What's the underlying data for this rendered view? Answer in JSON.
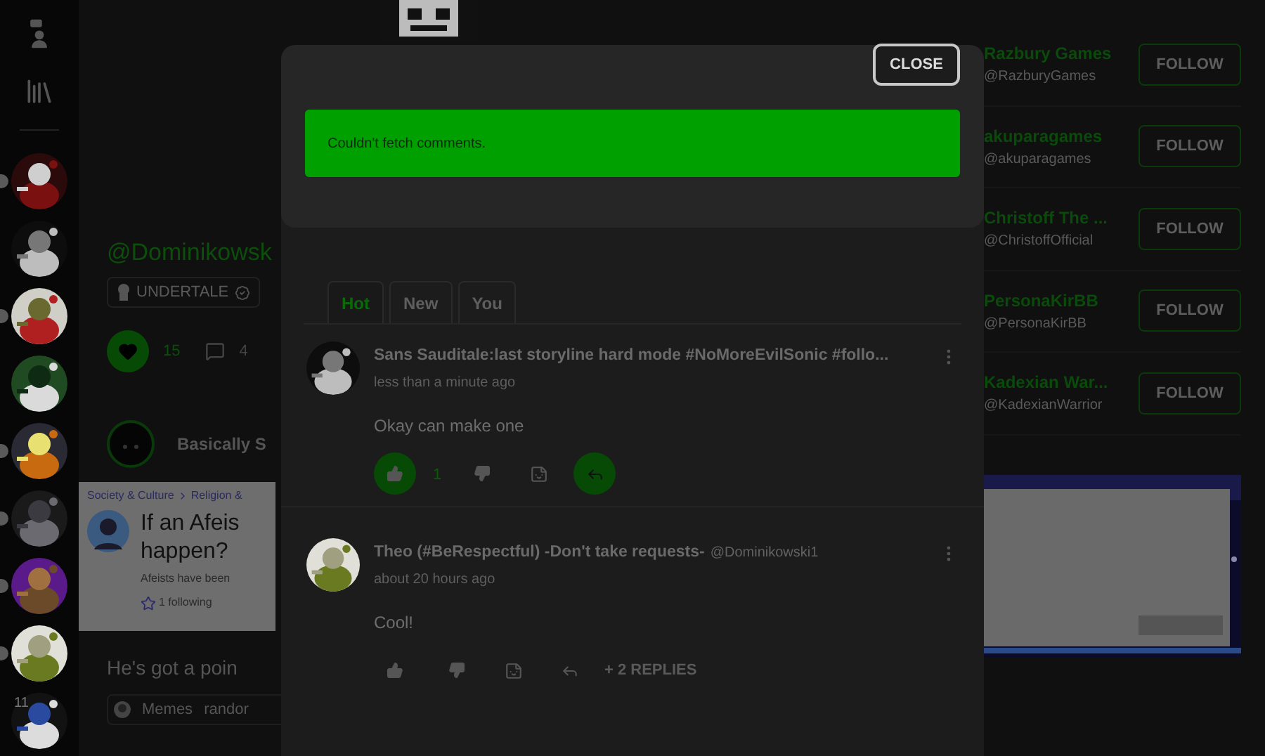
{
  "sidebar": {
    "avatars": [
      {
        "unread": true
      },
      {
        "unread": false
      },
      {
        "unread": true
      },
      {
        "unread": false
      },
      {
        "unread": true
      },
      {
        "unread": true
      },
      {
        "unread": true
      },
      {
        "unread": true
      },
      {
        "unread": false,
        "badge": "11"
      }
    ]
  },
  "feed": {
    "post": {
      "handle": "@Dominikowsk",
      "tag": "UNDERTALE",
      "liked": true,
      "likes": "15",
      "comments": "4"
    },
    "post_2": {
      "author": "Basically S",
      "embed": {
        "breadcrumb": [
          "Society & Culture",
          "Religion &"
        ],
        "title_lines": [
          "If an Afeis",
          "happen?"
        ],
        "excerpt": "Afeists have been",
        "following": "1 following"
      },
      "caption": "He's got a poin",
      "tags": [
        "Memes",
        "randor"
      ]
    }
  },
  "suggestions": [
    {
      "name": "Razbury Games",
      "handle": "@RazburyGames",
      "button": "FOLLOW"
    },
    {
      "name": "akuparagames",
      "handle": "@akuparagames",
      "button": "FOLLOW"
    },
    {
      "name": "Christoff The ...",
      "handle": "@ChristoffOfficial",
      "button": "FOLLOW"
    },
    {
      "name": "PersonaKirBB",
      "handle": "@PersonaKirBB",
      "button": "FOLLOW"
    },
    {
      "name": "Kadexian War...",
      "handle": "@KadexianWarrior",
      "button": "FOLLOW"
    }
  ],
  "modal": {
    "close": "CLOSE",
    "alert": "Couldn't fetch comments.",
    "tabs": [
      {
        "label": "Hot",
        "selected": true
      },
      {
        "label": "New",
        "selected": false
      },
      {
        "label": "You",
        "selected": false
      }
    ],
    "comments": [
      {
        "author": "Sans Sauditale:last storyline hard mode #NoMoreEvilSonic #follo...",
        "time": "less than a minute ago",
        "text": "Okay can make one",
        "liked": true,
        "likes": "1",
        "reply_active": true
      },
      {
        "author": "Theo (#BeRespectful) -Don't take requests-",
        "handle": "@Dominikowski1",
        "time": "about 20 hours ago",
        "text": "Cool!",
        "liked": false,
        "reply_active": false,
        "replies": "+ 2 REPLIES"
      }
    ]
  }
}
